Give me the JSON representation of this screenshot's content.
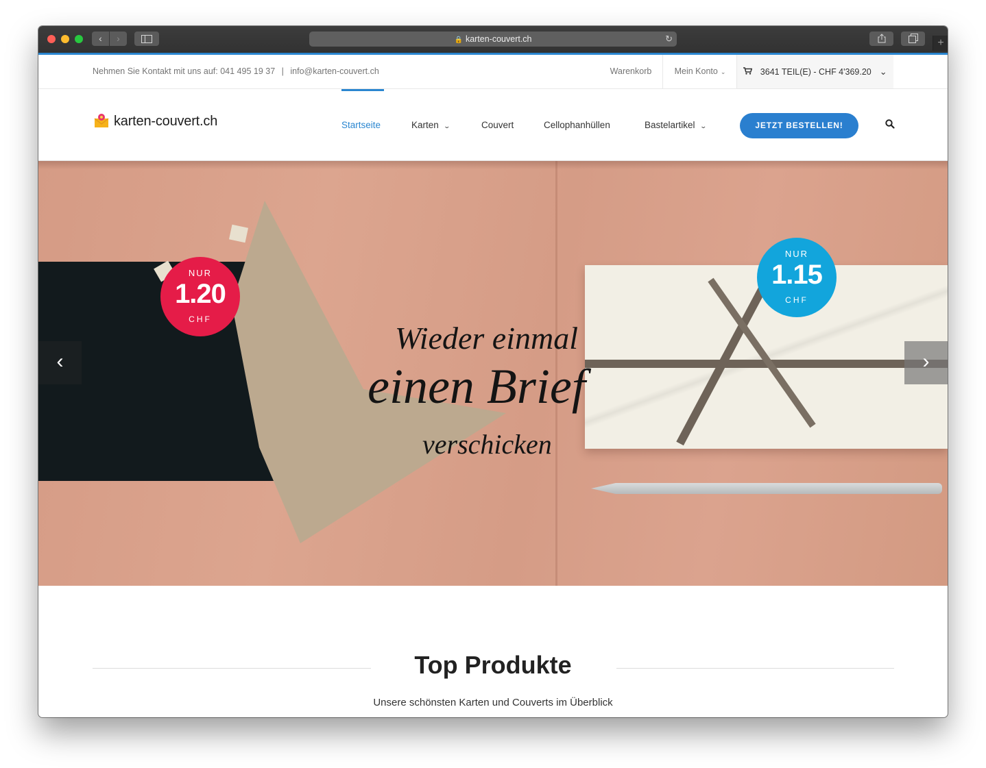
{
  "browser": {
    "url": "karten-couvert.ch"
  },
  "topbar": {
    "contact_prefix": "Nehmen Sie Kontakt mit uns auf:",
    "phone": "041 495 19 37",
    "separator": "|",
    "email": "info@karten-couvert.ch",
    "warenkorb": "Warenkorb",
    "mein_konto": "Mein Konto",
    "cart_summary": "3641 TEIL(E) - CHF 4'369.20"
  },
  "header": {
    "logo_text": "karten-couvert.ch",
    "nav": [
      {
        "label": "Startseite"
      },
      {
        "label": "Karten"
      },
      {
        "label": "Couvert"
      },
      {
        "label": "Cellophanhüllen"
      },
      {
        "label": "Bastelartikel"
      }
    ],
    "cta": "JETZT BESTELLEN!"
  },
  "hero": {
    "line1": "Wieder einmal",
    "line2": "einen Brief",
    "line3": "verschicken",
    "badge_left": {
      "top": "NUR",
      "price": "1.20",
      "bottom": "CHF"
    },
    "badge_right": {
      "top": "NUR",
      "price": "1.15",
      "bottom": "CHF"
    }
  },
  "section": {
    "title": "Top Produkte",
    "subtitle": "Unsere schönsten Karten und Couverts im Überblick"
  },
  "colors": {
    "accent": "#2a86d0",
    "badge_red": "#e51c48",
    "badge_blue": "#12a5dc"
  }
}
